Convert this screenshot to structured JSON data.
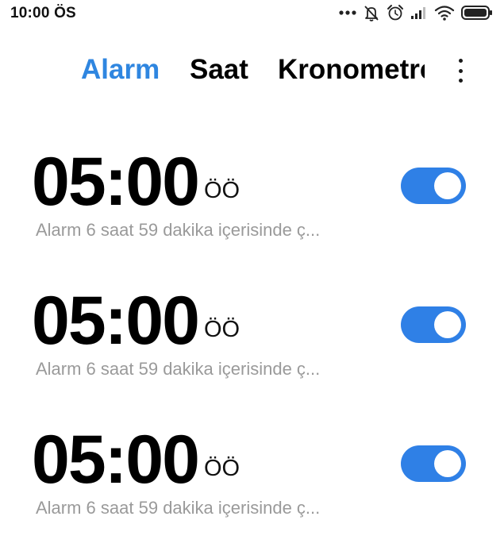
{
  "status_bar": {
    "time": "10:00 ÖS",
    "icons": [
      "more-dots-icon",
      "notifications-off-icon",
      "alarm-clock-icon",
      "signal-icon",
      "wifi-icon",
      "battery-icon"
    ]
  },
  "tabs": [
    {
      "label": "Alarm",
      "active": true
    },
    {
      "label": "Saat",
      "active": false
    },
    {
      "label": "Kronometre",
      "active": false
    }
  ],
  "menu": {
    "icon": "more-vertical-icon"
  },
  "colors": {
    "accent": "#2f86e0",
    "toggle_on": "#2f80e6",
    "subtext": "#9a9a9a"
  },
  "alarms": [
    {
      "time": "05:00",
      "ampm": "ÖÖ",
      "description": "Alarm 6 saat 59 dakika içerisinde ç...",
      "enabled": true
    },
    {
      "time": "05:00",
      "ampm": "ÖÖ",
      "description": "Alarm 6 saat 59 dakika içerisinde ç...",
      "enabled": true
    },
    {
      "time": "05:00",
      "ampm": "ÖÖ",
      "description": "Alarm 6 saat 59 dakika içerisinde ç...",
      "enabled": true
    }
  ]
}
